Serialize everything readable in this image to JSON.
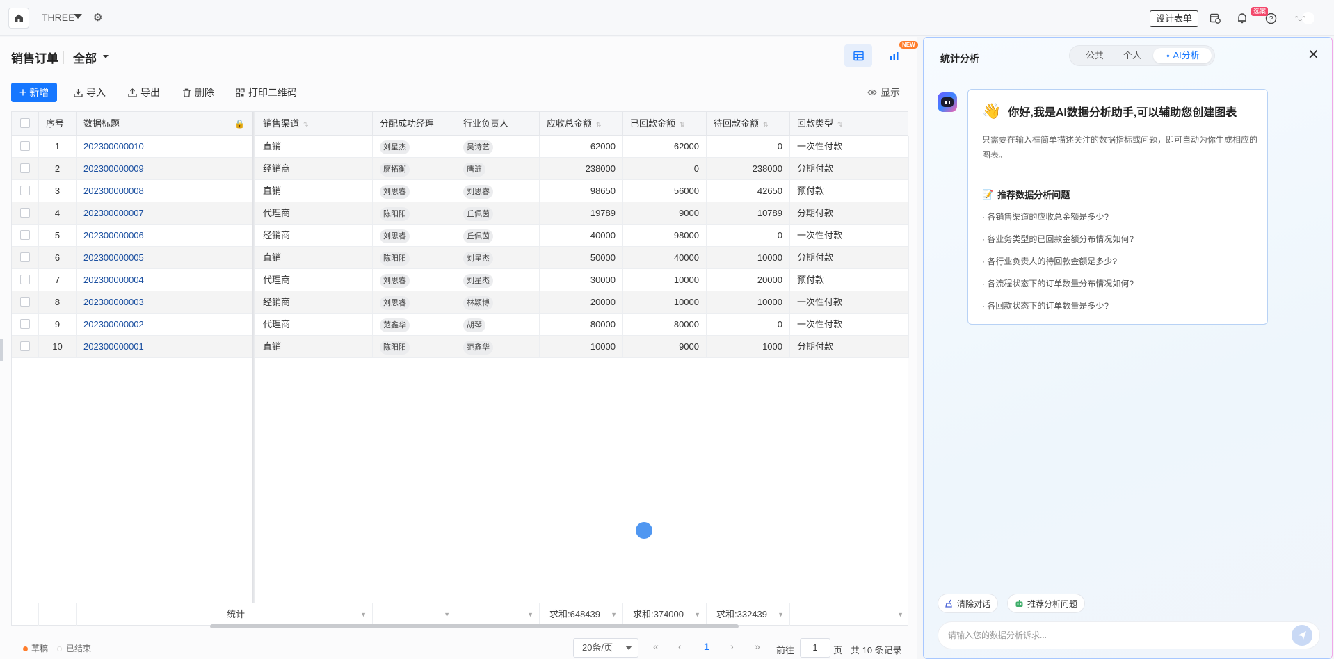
{
  "topbar": {
    "app_name": "THREE",
    "design_btn": "设计表单",
    "badge": "选案"
  },
  "main": {
    "title": "销售订单",
    "view": "全部",
    "new_tag": "NEW"
  },
  "toolbar": {
    "add": "新增",
    "import": "导入",
    "export": "导出",
    "delete": "删除",
    "qrcode": "打印二维码",
    "display": "显示"
  },
  "table": {
    "headers": {
      "seq": "序号",
      "title": "数据标题",
      "channel": "销售渠道",
      "manager": "分配成功经理",
      "owner": "行业负责人",
      "total": "应收总金额",
      "received": "已回款金额",
      "pending": "待回款金额",
      "paytype": "回款类型"
    },
    "rows": [
      {
        "seq": "1",
        "title": "202300000010",
        "channel": "直销",
        "manager": "刘星杰",
        "owner": "吴诗艺",
        "total": "62000",
        "received": "62000",
        "pending": "0",
        "paytype": "一次性付款"
      },
      {
        "seq": "2",
        "title": "202300000009",
        "channel": "经销商",
        "manager": "廖拓衡",
        "owner": "唐涟",
        "total": "238000",
        "received": "0",
        "pending": "238000",
        "paytype": "分期付款"
      },
      {
        "seq": "3",
        "title": "202300000008",
        "channel": "直销",
        "manager": "刘思睿",
        "owner": "刘思睿",
        "total": "98650",
        "received": "56000",
        "pending": "42650",
        "paytype": "预付款"
      },
      {
        "seq": "4",
        "title": "202300000007",
        "channel": "代理商",
        "manager": "陈阳阳",
        "owner": "丘佩茵",
        "total": "19789",
        "received": "9000",
        "pending": "10789",
        "paytype": "分期付款"
      },
      {
        "seq": "5",
        "title": "202300000006",
        "channel": "经销商",
        "manager": "刘思睿",
        "owner": "丘佩茵",
        "total": "40000",
        "received": "98000",
        "pending": "0",
        "paytype": "一次性付款"
      },
      {
        "seq": "6",
        "title": "202300000005",
        "channel": "直销",
        "manager": "陈阳阳",
        "owner": "刘星杰",
        "total": "50000",
        "received": "40000",
        "pending": "10000",
        "paytype": "分期付款"
      },
      {
        "seq": "7",
        "title": "202300000004",
        "channel": "代理商",
        "manager": "刘思睿",
        "owner": "刘星杰",
        "total": "30000",
        "received": "10000",
        "pending": "20000",
        "paytype": "预付款"
      },
      {
        "seq": "8",
        "title": "202300000003",
        "channel": "经销商",
        "manager": "刘思睿",
        "owner": "林颖博",
        "total": "20000",
        "received": "10000",
        "pending": "10000",
        "paytype": "一次性付款"
      },
      {
        "seq": "9",
        "title": "202300000002",
        "channel": "代理商",
        "manager": "范鑫华",
        "owner": "胡琴",
        "total": "80000",
        "received": "80000",
        "pending": "0",
        "paytype": "一次性付款"
      },
      {
        "seq": "10",
        "title": "202300000001",
        "channel": "直销",
        "manager": "陈阳阳",
        "owner": "范鑫华",
        "total": "10000",
        "received": "9000",
        "pending": "1000",
        "paytype": "分期付款"
      }
    ],
    "footer": {
      "label": "统计",
      "total_sum": "求和:648439",
      "received_sum": "求和:374000",
      "pending_sum": "求和:332439"
    }
  },
  "legend": {
    "draft": "草稿",
    "ended": "已结束"
  },
  "pager": {
    "page_size": "20条/页",
    "current": "1",
    "goto_label": "前往",
    "goto_value": "1",
    "page_unit": "页",
    "total": "共 10 条记录"
  },
  "panel": {
    "title": "统计分析",
    "tabs": [
      "公共",
      "个人",
      "AI分析"
    ],
    "greeting": "你好,我是AI数据分析助手,可以辅助您创建图表",
    "greeting_emoji": "👋",
    "desc": "只需要在输入框简单描述关注的数据指标或问题，即可自动为你生成相应的图表。",
    "rec_title": "推荐数据分析问题",
    "rec_emoji": "📝",
    "questions": [
      "· 各销售渠道的应收总金额是多少?",
      "· 各业务类型的已回款金额分布情况如何?",
      "· 各行业负责人的待回款金额是多少?",
      "· 各流程状态下的订单数量分布情况如何?",
      "· 各回款状态下的订单数量是多少?"
    ],
    "clear_btn": "清除对话",
    "recommend_btn": "推荐分析问题",
    "input_placeholder": "请输入您的数据分析诉求..."
  },
  "colors": {
    "primary": "#1677ff",
    "link": "#1a4fa0",
    "draft_dot": "#ff7d2c"
  }
}
